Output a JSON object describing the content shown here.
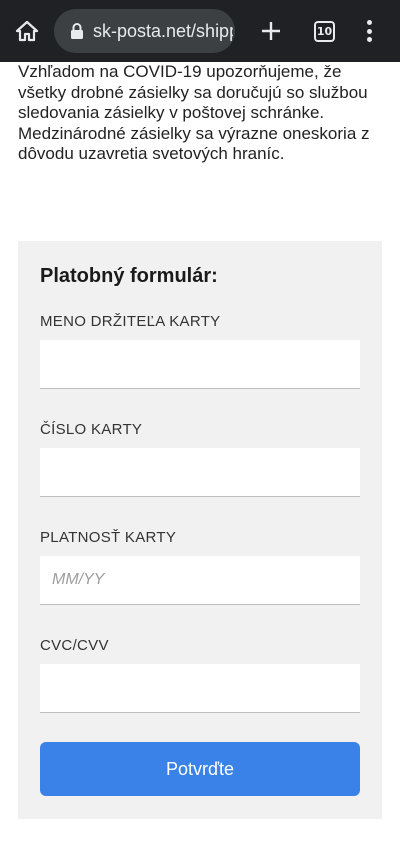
{
  "browser": {
    "url": "sk-posta.net/shipping",
    "tab_count": "10",
    "colors": {
      "bar": "#202124",
      "pill": "#3c4043",
      "icon": "#e8eaed"
    },
    "icons": [
      "home-icon",
      "lock-icon",
      "plus-icon",
      "tab-switcher-icon",
      "more-vert-icon"
    ]
  },
  "notice": {
    "text": "Vzhľadom na COVID-19 upozorňujeme, že všetky drobné zásielky sa doručujú so službou sledovania zásielky v poštovej schránke. Medzinárodné zásielky sa výrazne oneskoria z dôvodu uzavretia svetových hraníc."
  },
  "form": {
    "title": "Platobný formulár:",
    "fields": [
      {
        "label": "MENO DRŽITEĽA KARTY",
        "value": "",
        "placeholder": ""
      },
      {
        "label": "ČÍSLO KARTY",
        "value": "",
        "placeholder": ""
      },
      {
        "label": "PLATNOSŤ KARTY",
        "value": "",
        "placeholder": "MM/YY"
      },
      {
        "label": "CVC/CVV",
        "value": "",
        "placeholder": ""
      }
    ],
    "submit_label": "Potvrďte",
    "colors": {
      "card": "#f1f1f1",
      "button": "#3b82e8"
    }
  }
}
